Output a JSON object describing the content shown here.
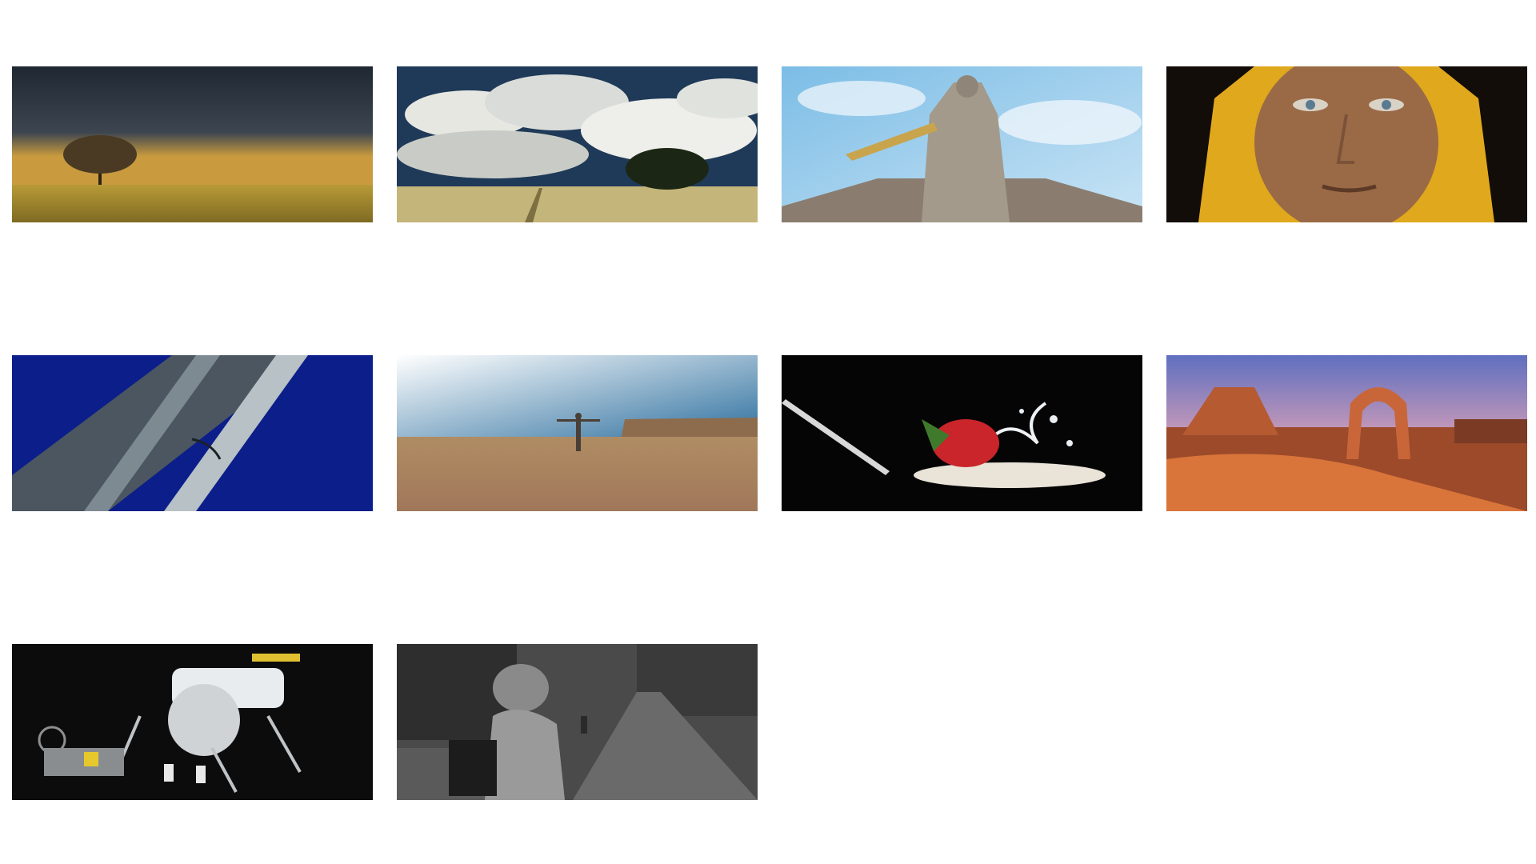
{
  "gallery": {
    "items": [
      {
        "id": 1,
        "icon": "lone-tree-field-photo",
        "alt": ""
      },
      {
        "id": 2,
        "icon": "tree-clouds-photo",
        "alt": ""
      },
      {
        "id": 3,
        "icon": "statue-sky-photo",
        "alt": ""
      },
      {
        "id": 4,
        "icon": "woman-portrait-photo",
        "alt": ""
      },
      {
        "id": 5,
        "icon": "tower-blue-sky-photo",
        "alt": ""
      },
      {
        "id": 6,
        "icon": "desert-person-photo",
        "alt": ""
      },
      {
        "id": 7,
        "icon": "strawberry-milk-splash-photo",
        "alt": ""
      },
      {
        "id": 8,
        "icon": "desert-arch-photo",
        "alt": ""
      },
      {
        "id": 9,
        "icon": "lego-lunar-lander-photo",
        "alt": ""
      },
      {
        "id": 10,
        "icon": "street-photographer-bw-photo",
        "alt": ""
      }
    ]
  },
  "colors": {
    "background": "#ffffff"
  }
}
